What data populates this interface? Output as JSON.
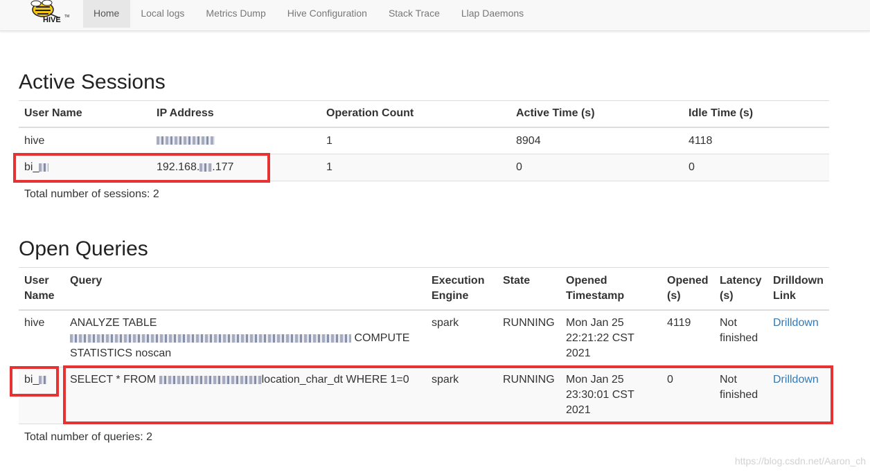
{
  "brand": {
    "logo_text": "HIVE",
    "trademark": "TM"
  },
  "nav": {
    "items": [
      {
        "label": "Home",
        "active": true
      },
      {
        "label": "Local logs"
      },
      {
        "label": "Metrics Dump"
      },
      {
        "label": "Hive Configuration"
      },
      {
        "label": "Stack Trace"
      },
      {
        "label": "Llap Daemons"
      }
    ]
  },
  "active_sessions": {
    "title": "Active Sessions",
    "headers": [
      "User Name",
      "IP Address",
      "Operation Count",
      "Active Time (s)",
      "Idle Time (s)"
    ],
    "rows": [
      {
        "user": "hive",
        "ip": "",
        "op_count": "1",
        "active": "8904",
        "idle": "4118"
      },
      {
        "user": "bi_",
        "ip": "192.168.",
        "ip_tail": ".177",
        "op_count": "1",
        "active": "0",
        "idle": "0"
      }
    ],
    "total": "Total number of sessions: 2"
  },
  "open_queries": {
    "title": "Open Queries",
    "headers": {
      "user": "User Name",
      "query": "Query",
      "engine": "Execution Engine",
      "state": "State",
      "opened_ts": "Opened Timestamp",
      "opened_s": "Opened (s)",
      "latency": "Latency (s)",
      "drill": "Drilldown Link"
    },
    "rows": [
      {
        "user": "hive",
        "query_line1": "ANALYZE TABLE",
        "query_line2_tail": "COMPUTE",
        "query_line3": "STATISTICS noscan",
        "engine": "spark",
        "state": "RUNNING",
        "opened_ts_1": "Mon Jan 25",
        "opened_ts_2": "22:21:22 CST",
        "opened_ts_3": "2021",
        "opened_s": "4119",
        "latency_1": "Not",
        "latency_2": "finished",
        "drill": "Drilldown"
      },
      {
        "user": "bi_",
        "query_pre": "SELECT * FROM",
        "query_post": "location_char_dt WHERE 1=0",
        "engine": "spark",
        "state": "RUNNING",
        "opened_ts_1": "Mon Jan 25",
        "opened_ts_2": "23:30:01 CST",
        "opened_ts_3": "2021",
        "opened_s": "0",
        "latency_1": "Not",
        "latency_2": "finished",
        "drill": "Drilldown"
      }
    ],
    "total": "Total number of queries: 2"
  },
  "watermark": "https://blog.csdn.net/Aaron_ch",
  "colors": {
    "highlight": "#e53333",
    "link": "#337ab7",
    "logo": "#f5c518"
  }
}
